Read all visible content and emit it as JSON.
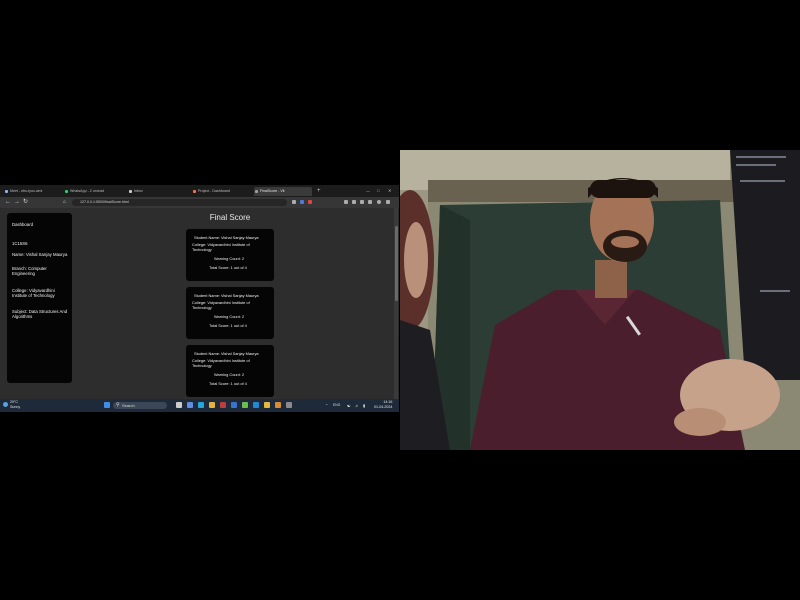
{
  "browser": {
    "tabs": [
      {
        "label": "Meet - ebs-tyoc-wmi",
        "active": false,
        "color": "#8ab4f8"
      },
      {
        "label": "WhatsApp - 2 unread",
        "active": false,
        "color": "#25d366"
      },
      {
        "label": "Inbox",
        "active": false,
        "color": "#cccccc"
      },
      {
        "label": "Project - Dashboard",
        "active": false,
        "color": "#ff7043"
      },
      {
        "label": "FinalScore - Vit",
        "active": true,
        "color": "#9e9e9e"
      }
    ],
    "new_tab": "+",
    "url": "127.0.0.1:5500/finalScore.html"
  },
  "sidebar": {
    "items": [
      {
        "label": "Dashboard"
      },
      {
        "label": "1C16S6"
      },
      {
        "label": "Name: Vishal Sanjay Maurya"
      },
      {
        "label": "Branch: Computer Engineering"
      },
      {
        "label": "College: Vidyavardhini Institute of Technology"
      },
      {
        "label": "Subject: Data Structures And Algorithms"
      }
    ]
  },
  "main": {
    "title": "Final Score",
    "cards": [
      {
        "name": "Student Name: Vishal Sanjay Maurya",
        "college": "College: Vidyavardhini Institute of Technology",
        "warning": "Warning Count: 2",
        "score": "Total Score: 1 out of 4"
      },
      {
        "name": "Student Name: Vishal Sanjay Maurya",
        "college": "College: Vidyavardhini Institute of Technology",
        "warning": "Warning Count: 2",
        "score": "Total Score: 1 out of 4"
      },
      {
        "name": "Student Name: Vishal Sanjay Maurya",
        "college": "College: Vidyavardhini Institute of Technology",
        "warning": "Warning Count: 2",
        "score": "Total Score: 1 out of 4"
      }
    ]
  },
  "taskbar": {
    "weather_temp": "29°C",
    "weather_desc": "Sunny",
    "search_placeholder": "Search",
    "clock_time": "14:16",
    "clock_date": "01-04-2024",
    "tray_lang": "ENG"
  },
  "camera": {
    "content": "webcam feed of a participant"
  }
}
